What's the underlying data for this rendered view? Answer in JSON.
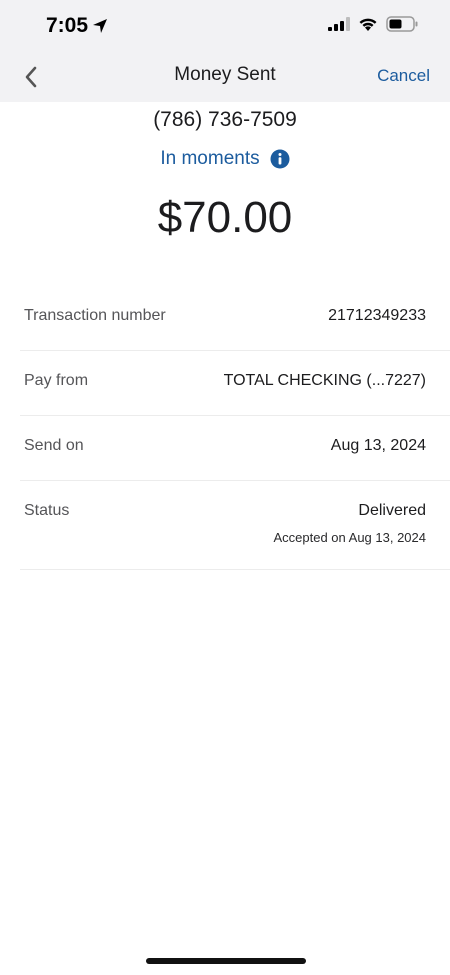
{
  "status_bar": {
    "time": "7:05",
    "icons": [
      "location-arrow-icon",
      "signal-icon",
      "wifi-icon",
      "battery-icon"
    ]
  },
  "nav": {
    "back_icon": "chevron-left-icon",
    "title": "Money Sent",
    "cancel_label": "Cancel"
  },
  "summary": {
    "phone": "(786) 736-7509",
    "timing_label": "In moments",
    "info_icon": "info-icon",
    "amount": "$70.00"
  },
  "details": [
    {
      "label": "Transaction number",
      "value": "21712349233"
    },
    {
      "label": "Pay from",
      "value": "TOTAL CHECKING (...7227)"
    },
    {
      "label": "Send on",
      "value": "Aug 13, 2024"
    },
    {
      "label": "Status",
      "value": "Delivered",
      "subvalue": "Accepted on Aug 13, 2024"
    }
  ],
  "colors": {
    "accent": "#1c5c9e",
    "header_bg": "#f2f2f4",
    "text": "#1c1c1e",
    "label": "#555558"
  }
}
